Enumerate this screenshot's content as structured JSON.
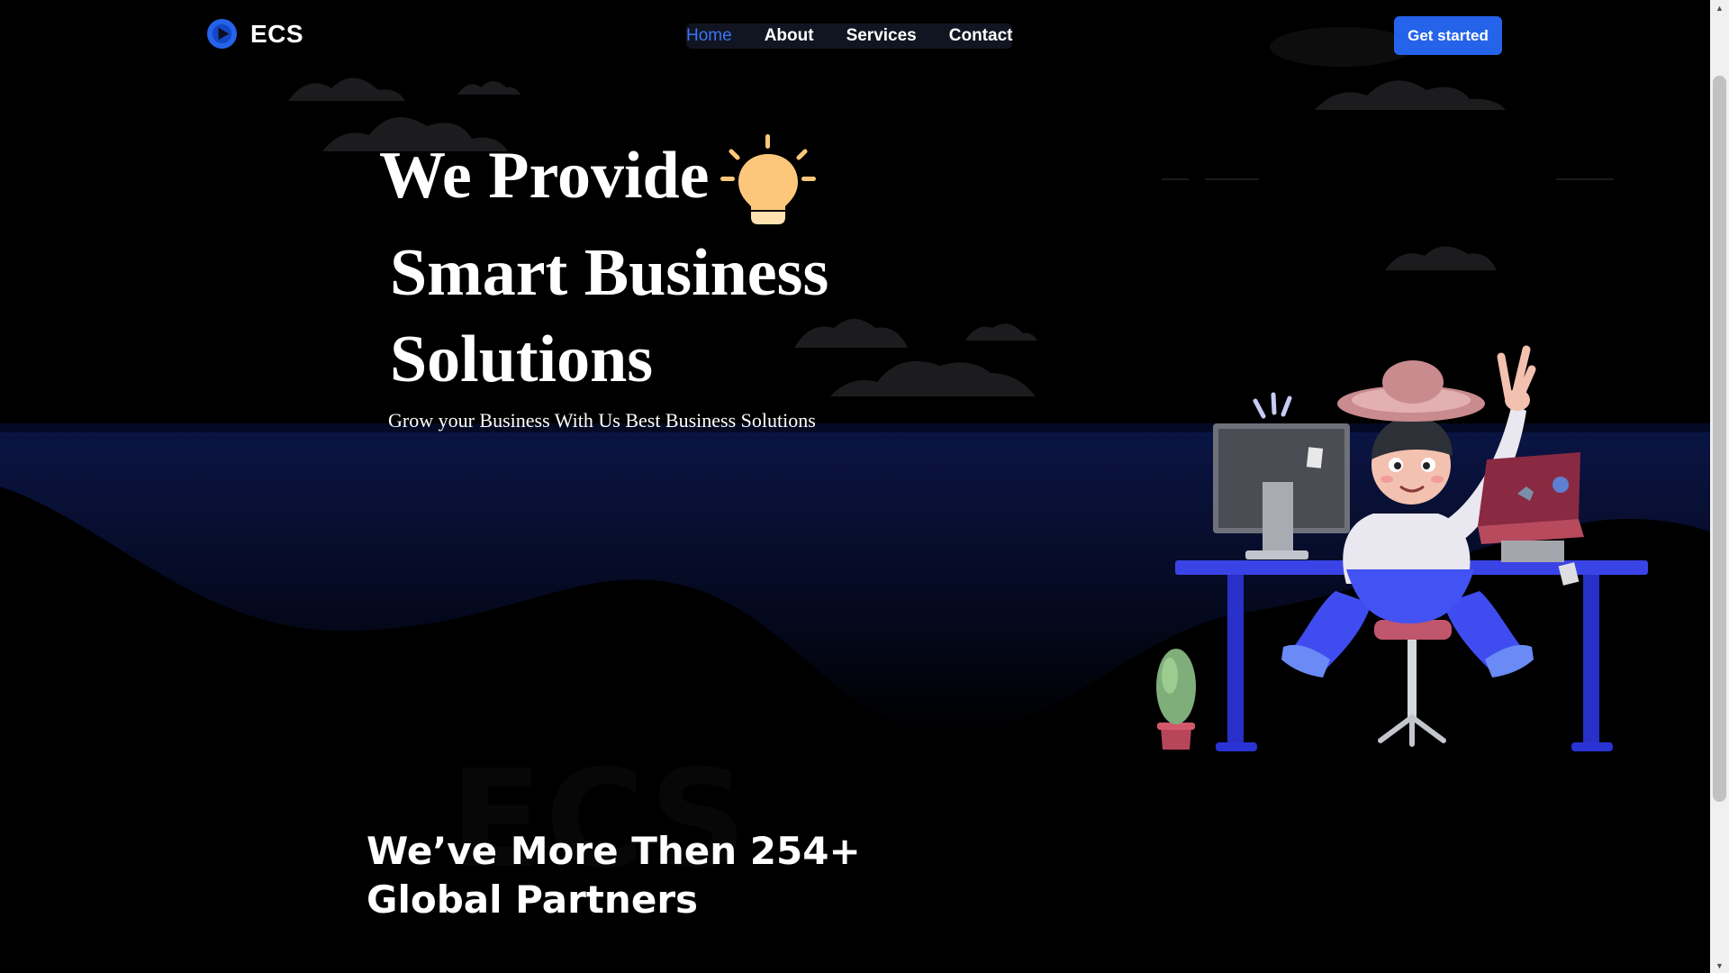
{
  "header": {
    "brand_name": "ECS",
    "nav": [
      "Home",
      "About",
      "Services",
      "Contact"
    ],
    "active_nav": "Home",
    "cta_label": "Get started"
  },
  "hero": {
    "line1": "We Provide",
    "line2": "Smart Business",
    "line3": "Solutions",
    "subtitle": "Grow your Business With Us Best Business Solutions"
  },
  "partners": {
    "watermark": "ECS",
    "title_line1": "We’ve More Then 254+",
    "title_line2": "Global Partners"
  },
  "colors": {
    "background": "#000000",
    "accent": "#2563eb",
    "active_link": "#3b73f0",
    "wave": "#0a1440",
    "bulb": "#fcc77a"
  },
  "icons": {
    "logo": "play-circle-icon",
    "hero": "lightbulb-icon"
  }
}
